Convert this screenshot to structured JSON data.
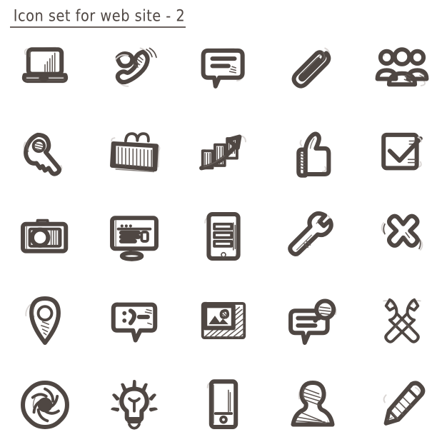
{
  "sheet": {
    "title": "Icon set for web site -  2",
    "background_color": "#ffffff",
    "ink_color": "#4f4743",
    "rule_color": "#6c6360",
    "columns": 5,
    "rows": 5,
    "total_icons": 25,
    "style": "hand-drawn sketch doodle outline"
  },
  "icons": [
    {
      "row": 1,
      "col": 1,
      "name": "laptop-icon",
      "label": "Laptop"
    },
    {
      "row": 1,
      "col": 2,
      "name": "phone-ringing-icon",
      "label": "Ringing telephone handset"
    },
    {
      "row": 1,
      "col": 3,
      "name": "speech-bubble-icon",
      "label": "Speech bubble with text lines"
    },
    {
      "row": 1,
      "col": 4,
      "name": "paperclip-icon",
      "label": "Paperclip attachment"
    },
    {
      "row": 1,
      "col": 5,
      "name": "users-group-icon",
      "label": "Group of users"
    },
    {
      "row": 2,
      "col": 1,
      "name": "key-icon",
      "label": "Key"
    },
    {
      "row": 2,
      "col": 2,
      "name": "briefcase-icon",
      "label": "Briefcase"
    },
    {
      "row": 2,
      "col": 3,
      "name": "growth-chart-icon",
      "label": "Bar chart with rising arrow"
    },
    {
      "row": 2,
      "col": 4,
      "name": "thumbs-up-icon",
      "label": "Thumbs up"
    },
    {
      "row": 2,
      "col": 5,
      "name": "checkbox-checked-icon",
      "label": "Checked checkbox"
    },
    {
      "row": 3,
      "col": 1,
      "name": "camera-icon",
      "label": "Photo camera"
    },
    {
      "row": 3,
      "col": 2,
      "name": "monitor-browser-icon",
      "label": "Desktop monitor with browser window"
    },
    {
      "row": 3,
      "col": 3,
      "name": "tablet-list-icon",
      "label": "Tablet with list content"
    },
    {
      "row": 3,
      "col": 4,
      "name": "wrench-icon",
      "label": "Wrench"
    },
    {
      "row": 3,
      "col": 5,
      "name": "close-cross-icon",
      "label": "Cross / close X"
    },
    {
      "row": 4,
      "col": 1,
      "name": "map-pin-icon",
      "label": "Map location pin"
    },
    {
      "row": 4,
      "col": 2,
      "name": "chat-emoticon-icon",
      "label": "Chat bubble with smiley emoticon"
    },
    {
      "row": 4,
      "col": 3,
      "name": "photo-gallery-icon",
      "label": "Picture frame / image gallery"
    },
    {
      "row": 4,
      "col": 4,
      "name": "search-bubble-icon",
      "label": "Speech bubble with magnifier"
    },
    {
      "row": 4,
      "col": 5,
      "name": "tools-crossed-icon",
      "label": "Crossed wrench and screwdriver"
    },
    {
      "row": 5,
      "col": 1,
      "name": "aperture-shutter-icon",
      "label": "Camera aperture shutter"
    },
    {
      "row": 5,
      "col": 2,
      "name": "lightbulb-icon",
      "label": "Light bulb idea"
    },
    {
      "row": 5,
      "col": 3,
      "name": "smartphone-icon",
      "label": "Smartphone"
    },
    {
      "row": 5,
      "col": 4,
      "name": "user-avatar-icon",
      "label": "User person silhouette"
    },
    {
      "row": 5,
      "col": 5,
      "name": "pencil-icon",
      "label": "Pencil edit"
    }
  ]
}
